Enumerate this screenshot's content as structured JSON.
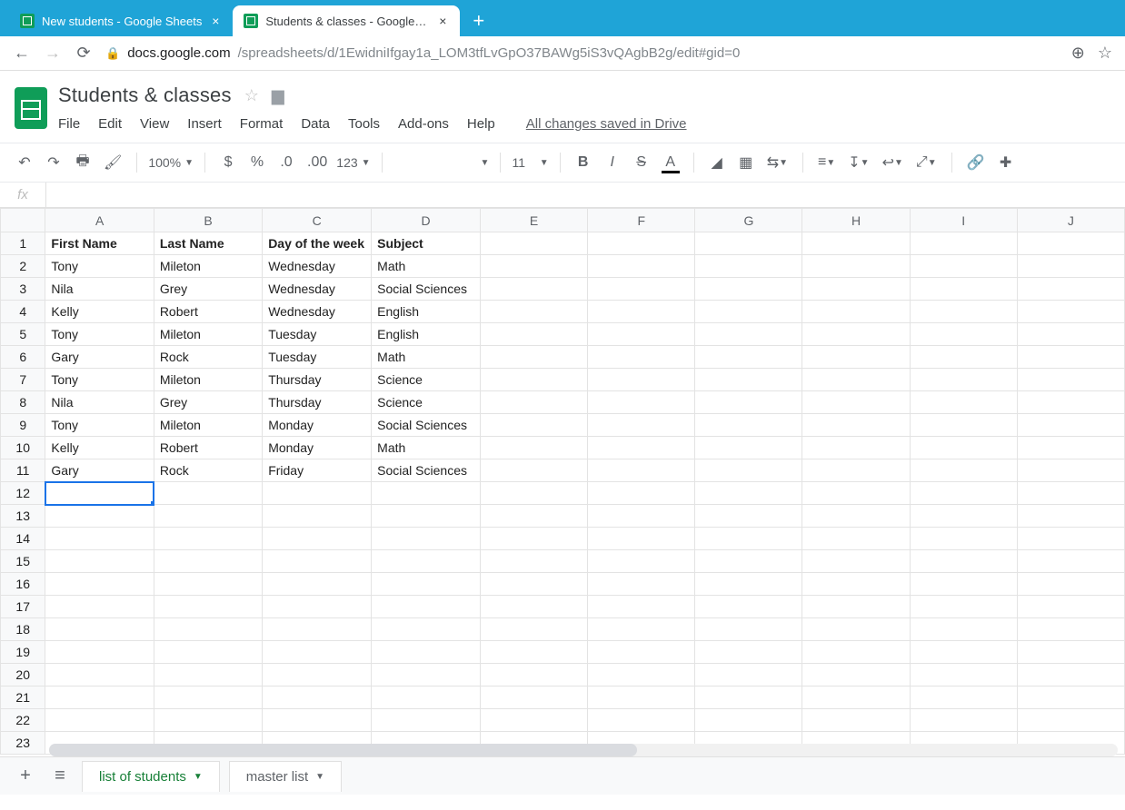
{
  "browser": {
    "tabs": [
      {
        "title": "New students - Google Sheets",
        "active": false
      },
      {
        "title": "Students & classes - Google She…",
        "active": true
      }
    ],
    "url_host": "docs.google.com",
    "url_path": "/spreadsheets/d/1EwidniIfgay1a_LOM3tfLvGpO37BAWg5iS3vQAgbB2g/edit#gid=0"
  },
  "doc": {
    "title": "Students & classes",
    "menus": [
      "File",
      "Edit",
      "View",
      "Insert",
      "Format",
      "Data",
      "Tools",
      "Add-ons",
      "Help"
    ],
    "drive_status": "All changes saved in Drive"
  },
  "toolbar": {
    "zoom": "100%",
    "font_size": "11",
    "more_formats": "123"
  },
  "columns": [
    {
      "letter": "A",
      "width": 120
    },
    {
      "letter": "B",
      "width": 120
    },
    {
      "letter": "C",
      "width": 120
    },
    {
      "letter": "D",
      "width": 120
    },
    {
      "letter": "E",
      "width": 120
    },
    {
      "letter": "F",
      "width": 120
    },
    {
      "letter": "G",
      "width": 120
    },
    {
      "letter": "H",
      "width": 120
    },
    {
      "letter": "I",
      "width": 120
    },
    {
      "letter": "J",
      "width": 120
    }
  ],
  "headers": [
    "First Name",
    "Last Name",
    "Day of the week",
    "Subject"
  ],
  "rows": [
    [
      "Tony",
      "Mileton",
      "Wednesday",
      "Math"
    ],
    [
      "Nila",
      "Grey",
      "Wednesday",
      "Social Sciences"
    ],
    [
      "Kelly",
      "Robert",
      "Wednesday",
      "English"
    ],
    [
      "Tony",
      "Mileton",
      "Tuesday",
      "English"
    ],
    [
      "Gary",
      "Rock",
      "Tuesday",
      "Math"
    ],
    [
      "Tony",
      "Mileton",
      "Thursday",
      "Science"
    ],
    [
      "Nila",
      "Grey",
      "Thursday",
      "Science"
    ],
    [
      "Tony",
      "Mileton",
      "Monday",
      "Social Sciences"
    ],
    [
      "Kelly",
      "Robert",
      "Monday",
      "Math"
    ],
    [
      "Gary",
      "Rock",
      "Friday",
      "Social Sciences"
    ]
  ],
  "total_visible_rows": 23,
  "selection": {
    "row": 12,
    "col": 0
  },
  "sheet_tabs": [
    {
      "name": "list of students",
      "active": true
    },
    {
      "name": "master list",
      "active": false
    }
  ]
}
